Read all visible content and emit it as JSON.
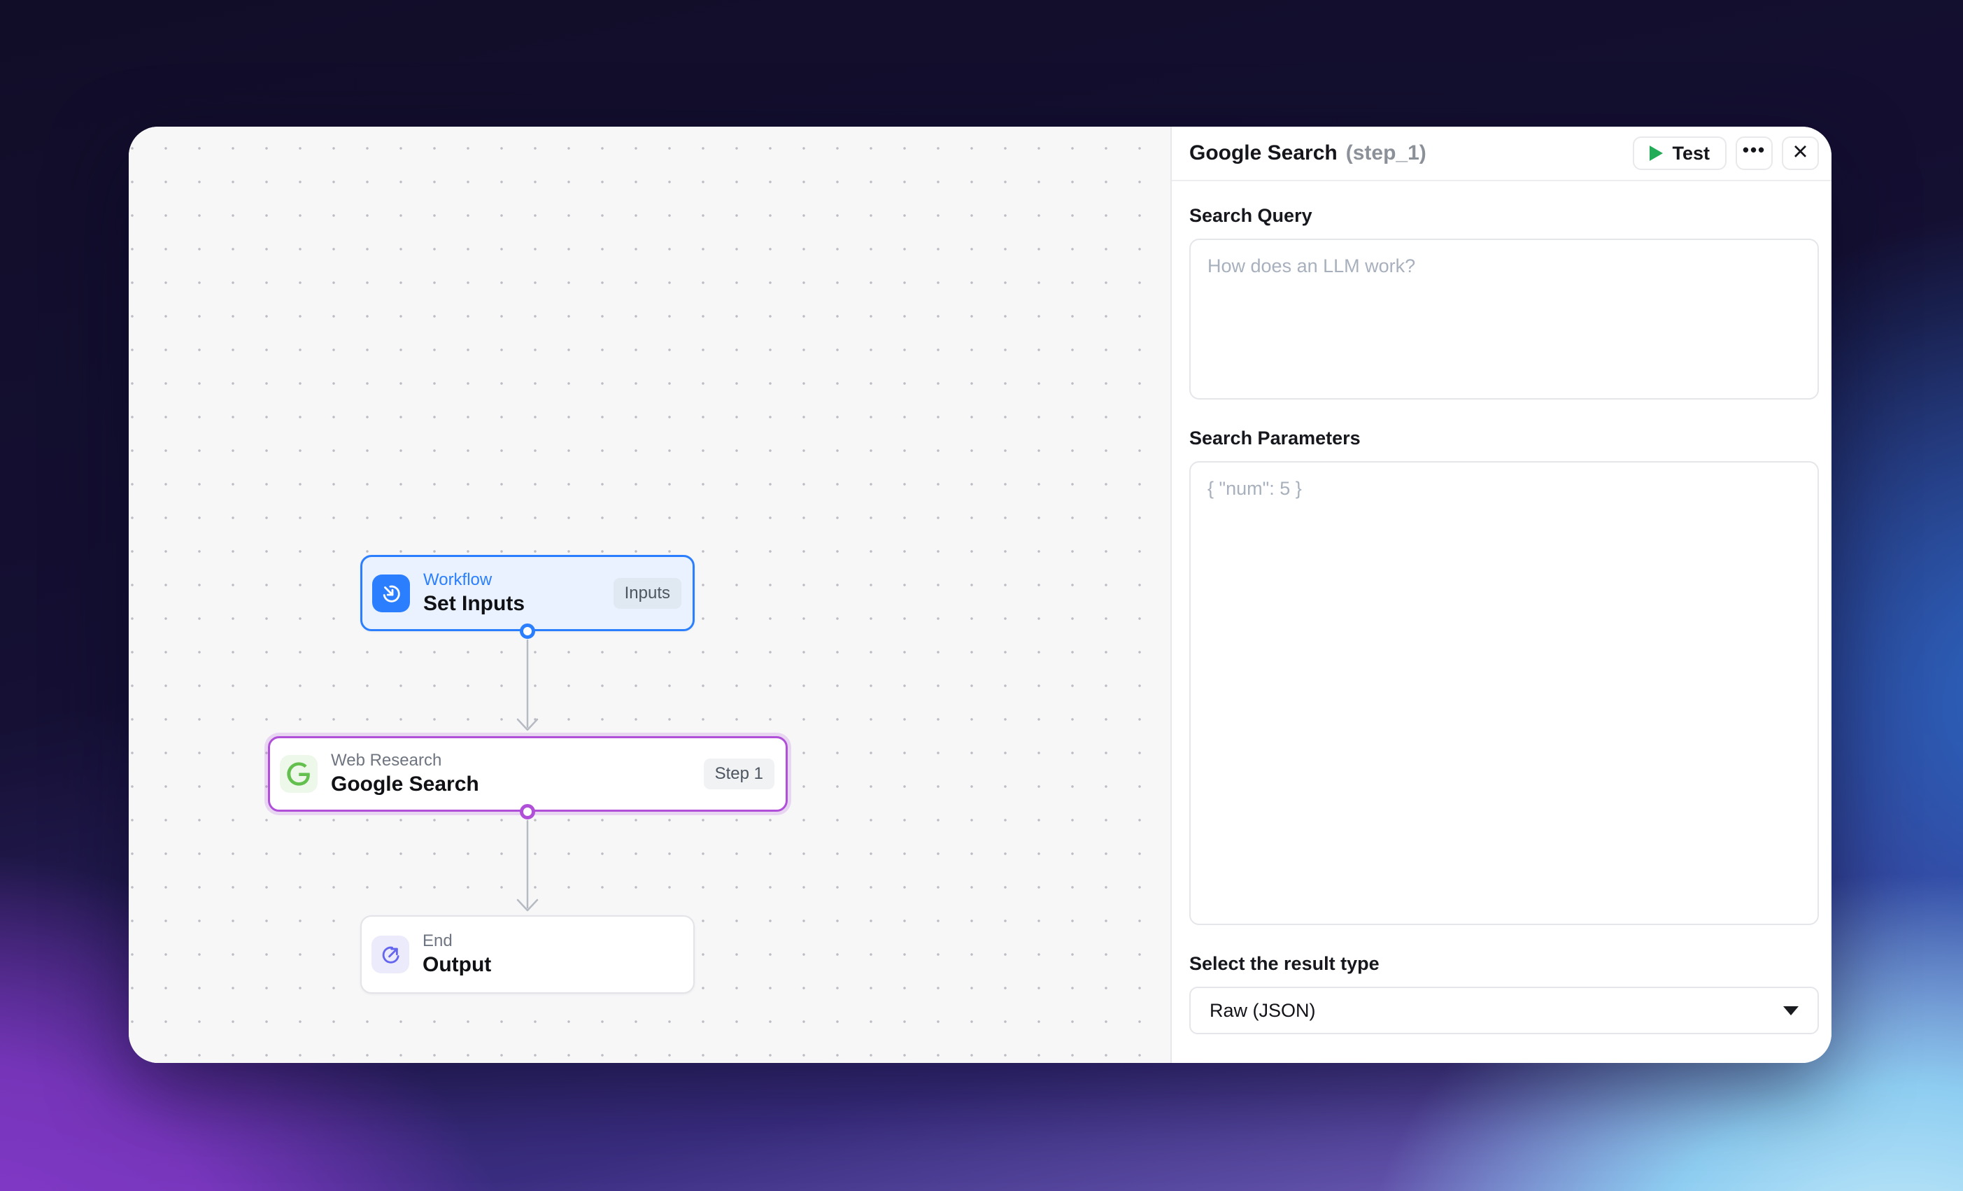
{
  "canvas": {
    "nodes": [
      {
        "category": "Workflow",
        "title": "Set Inputs",
        "badge": "Inputs",
        "icon": "arrow-into-circle-icon",
        "accent": "#2b7fff"
      },
      {
        "category": "Web Research",
        "title": "Google Search",
        "badge": "Step 1",
        "icon": "google-g-icon",
        "accent": "#b050d8"
      },
      {
        "category": "End",
        "title": "Output",
        "badge": "",
        "icon": "arrow-out-circle-icon",
        "accent": "#6467ee"
      }
    ],
    "edge_color": "#b6bac2"
  },
  "panel": {
    "header": {
      "title": "Google Search",
      "step_id": "(step_1)",
      "test_label": "Test",
      "more_icon": "•••",
      "close_icon": "×",
      "test_play_color": "#23ac57"
    },
    "sections": [
      {
        "label": "Search Query",
        "placeholder": "How does an LLM work?"
      },
      {
        "label": "Search Parameters",
        "placeholder": "{ \"num\": 5 }"
      }
    ],
    "result_type": {
      "label": "Select the result type",
      "value": "Raw (JSON)"
    }
  }
}
